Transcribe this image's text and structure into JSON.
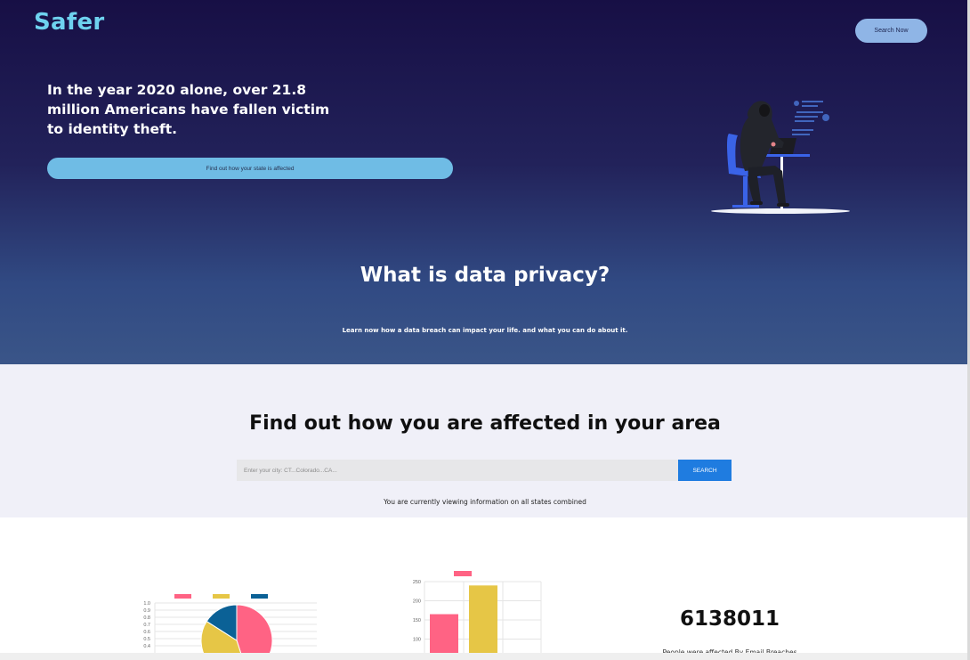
{
  "header": {
    "logo": "Safer",
    "search_now_label": "Search Now"
  },
  "hero": {
    "headline": "In the year 2020 alone, over 21.8 million Americans have fallen victim to identity theft.",
    "state_button_label": "Find out how your state is affected",
    "illustration_icon": "hacker-at-laptop-illustration"
  },
  "privacy": {
    "title": "What is data privacy?",
    "subtitle": "Learn now how a data breach can impact your life. and what you can do about it."
  },
  "search": {
    "title": "Find out how you are affected in your area",
    "placeholder": "Enter your city: CT...Colorado...CA...",
    "button_label": "SEARCH",
    "viewing_text": "You are currently viewing information on all states combined"
  },
  "stats": {
    "big_number": "6138011",
    "caption_partial": "People were affected By Email Breaches"
  },
  "colors": {
    "accent_logo": "#6ed2ef",
    "series_pink": "#ff6384",
    "series_yellow": "#e6c646",
    "series_blue": "#0b6196",
    "search_button": "#1f7ce0"
  },
  "chart_data": [
    {
      "type": "pie",
      "title": "",
      "legend": [
        "",
        "",
        ""
      ],
      "legend_placement": "top",
      "values": [
        45,
        39,
        16
      ],
      "colors": [
        "#ff6384",
        "#e6c646",
        "#0b6196"
      ],
      "background_y_ticks": [
        "1.0",
        "0.9",
        "0.8",
        "0.7",
        "0.6",
        "0.5",
        "0.4"
      ],
      "background_ylim": [
        0,
        1.0
      ],
      "grid": true
    },
    {
      "type": "bar",
      "title": "",
      "legend": [
        ""
      ],
      "legend_placement": "top",
      "categories": [
        "",
        ""
      ],
      "values": [
        165,
        240
      ],
      "colors": [
        "#ff6384",
        "#e6c646"
      ],
      "y_ticks": [
        "250",
        "200",
        "150",
        "100"
      ],
      "ylim": [
        0,
        250
      ],
      "grid": true
    }
  ]
}
